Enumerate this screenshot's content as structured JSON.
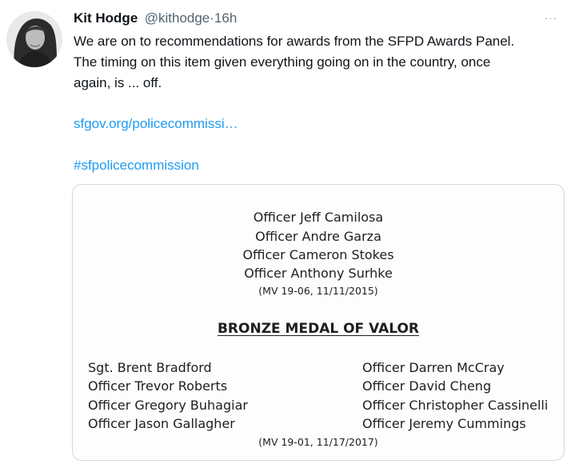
{
  "tweet": {
    "author_name": "Kit Hodge",
    "author_handle": "@kithodge",
    "separator": "·",
    "time": "16h",
    "more_label": "···",
    "text_lines": [
      "We are on to recommendations for awards from the SFPD Awards Panel.",
      "The timing on this item given everything going on in the country, once",
      "again, is ... off."
    ],
    "link_text": "sfgov.org/policecommissi…",
    "hashtag": "#sfpolicecommission"
  },
  "document": {
    "top_group": {
      "officers": [
        "Officer Jeff Camilosa",
        "Officer Andre Garza",
        "Officer Cameron Stokes",
        "Officer Anthony Surhke"
      ],
      "citation": "(MV 19-06, 11/11/2015)"
    },
    "bronze": {
      "heading": "BRONZE MEDAL OF VALOR",
      "left_column": [
        "Sgt. Brent Bradford",
        "Officer Trevor Roberts",
        "Officer Gregory Buhagiar",
        "Officer Jason Gallagher"
      ],
      "right_column": [
        "Officer Darren McCray",
        "Officer David Cheng",
        "Officer Christopher Cassinelli",
        "Officer Jeremy Cummings"
      ],
      "citation": "(MV 19-01, 11/17/2017)"
    }
  }
}
